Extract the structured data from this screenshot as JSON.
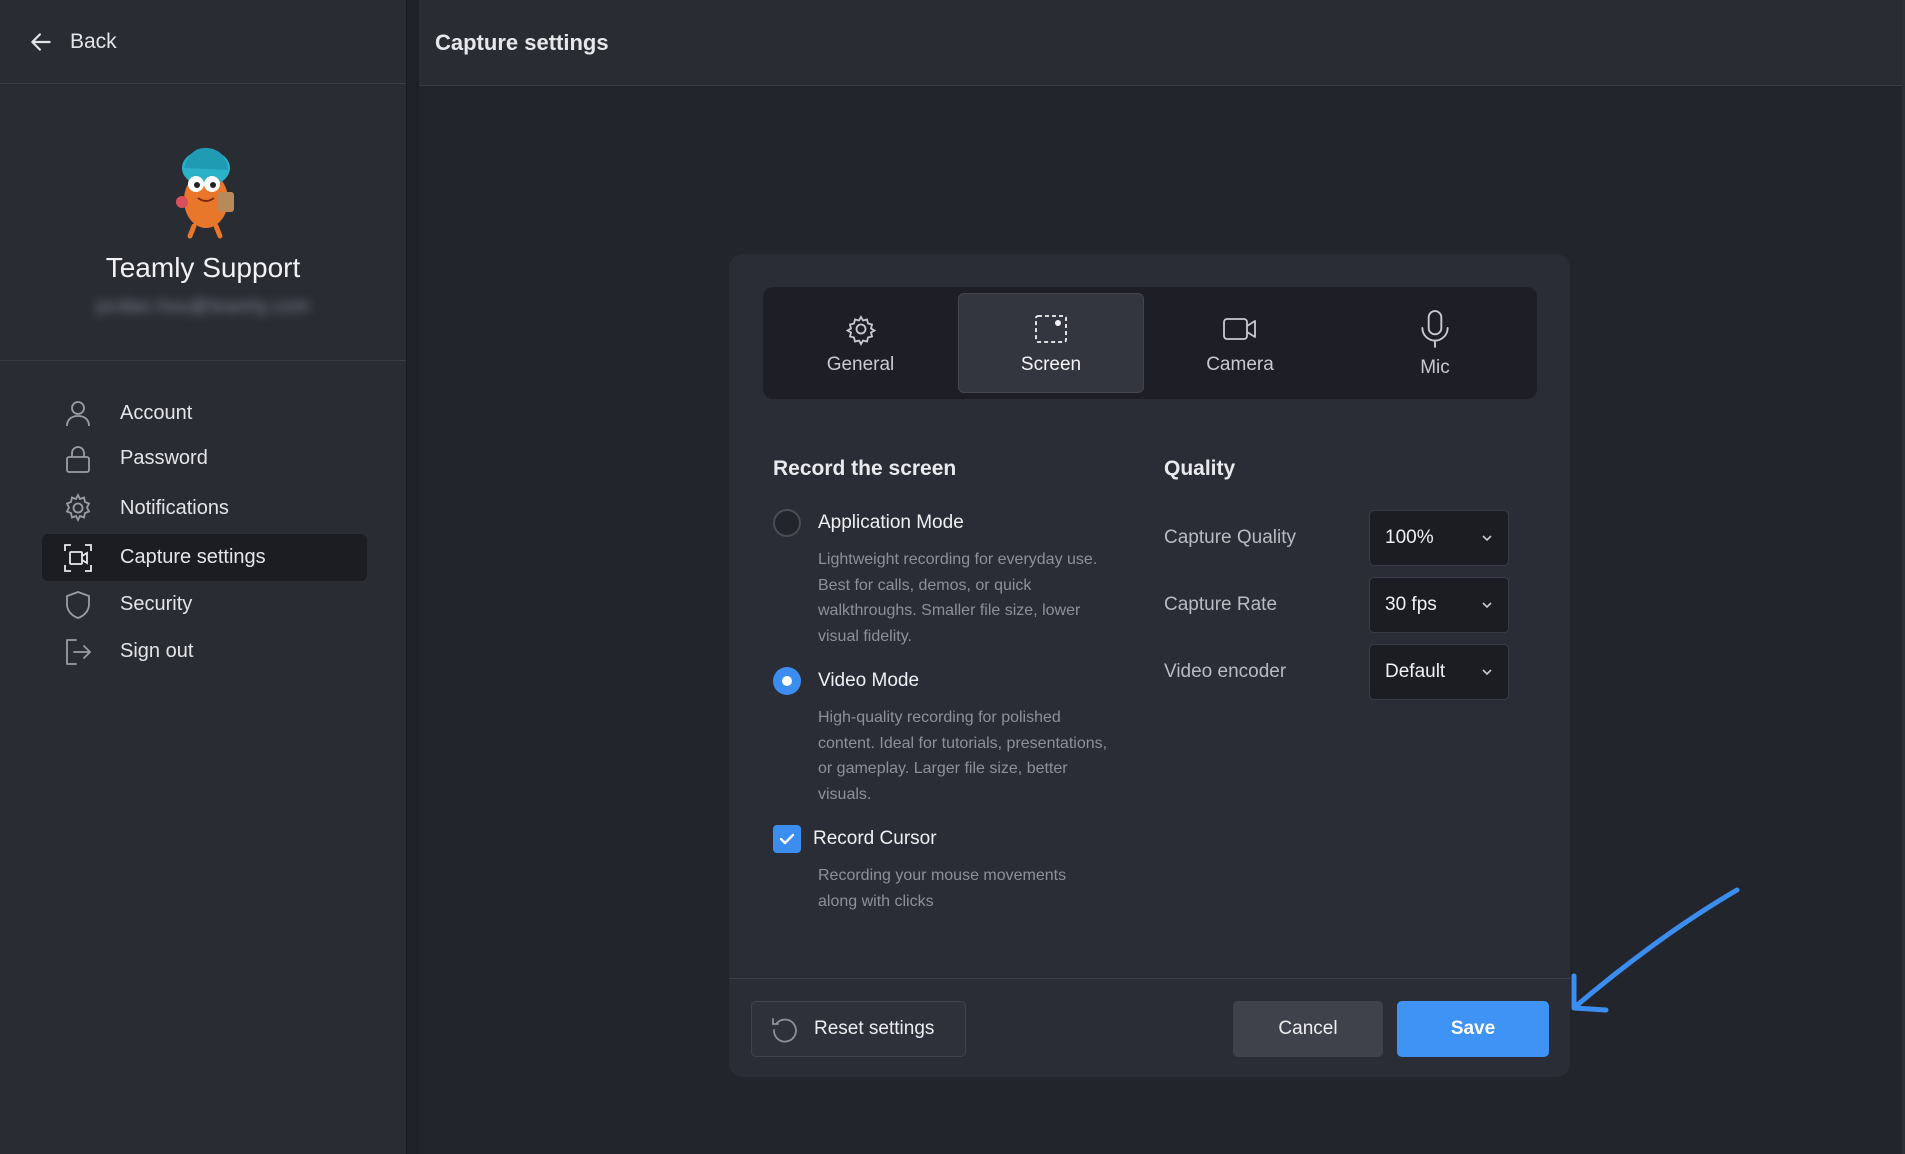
{
  "sidebar": {
    "back_label": "Back",
    "profile": {
      "name": "Teamly Support",
      "email": "jordan.hsu@teamly.com"
    },
    "items": [
      {
        "label": "Account",
        "icon": "user-icon"
      },
      {
        "label": "Password",
        "icon": "lock-icon"
      },
      {
        "label": "Notifications",
        "icon": "gear-icon"
      },
      {
        "label": "Capture settings",
        "icon": "capture-icon",
        "active": true
      },
      {
        "label": "Security",
        "icon": "shield-icon"
      },
      {
        "label": "Sign out",
        "icon": "sign-out-icon"
      }
    ]
  },
  "main": {
    "title": "Capture settings"
  },
  "modal": {
    "tabs": [
      {
        "label": "General",
        "icon": "gear-icon"
      },
      {
        "label": "Screen",
        "icon": "screen-record-icon",
        "active": true
      },
      {
        "label": "Camera",
        "icon": "camera-icon"
      },
      {
        "label": "Mic",
        "icon": "microphone-icon"
      }
    ],
    "record": {
      "title": "Record the screen",
      "options": [
        {
          "label": "Application Mode",
          "description": "Lightweight recording for everyday use. Best for calls, demos, or quick walkthroughs. Smaller file size, lower visual fidelity.",
          "selected": false
        },
        {
          "label": "Video Mode",
          "description": "High-quality recording for polished content. Ideal for tutorials, presentations, or gameplay. Larger file size, better visuals.",
          "selected": true
        }
      ],
      "cursor": {
        "label": "Record Cursor",
        "description": "Recording your mouse movements along with clicks",
        "checked": true
      }
    },
    "quality": {
      "title": "Quality",
      "rows": [
        {
          "label": "Capture Quality",
          "value": "100%"
        },
        {
          "label": "Capture Rate",
          "value": "30 fps"
        },
        {
          "label": "Video encoder",
          "value": "Default"
        }
      ]
    },
    "footer": {
      "reset_label": "Reset settings",
      "cancel_label": "Cancel",
      "save_label": "Save"
    }
  },
  "colors": {
    "accent": "#3e93f4",
    "background": "#23252d",
    "panel": "#2b2d36",
    "annotation_arrow": "#3b8ef0"
  }
}
